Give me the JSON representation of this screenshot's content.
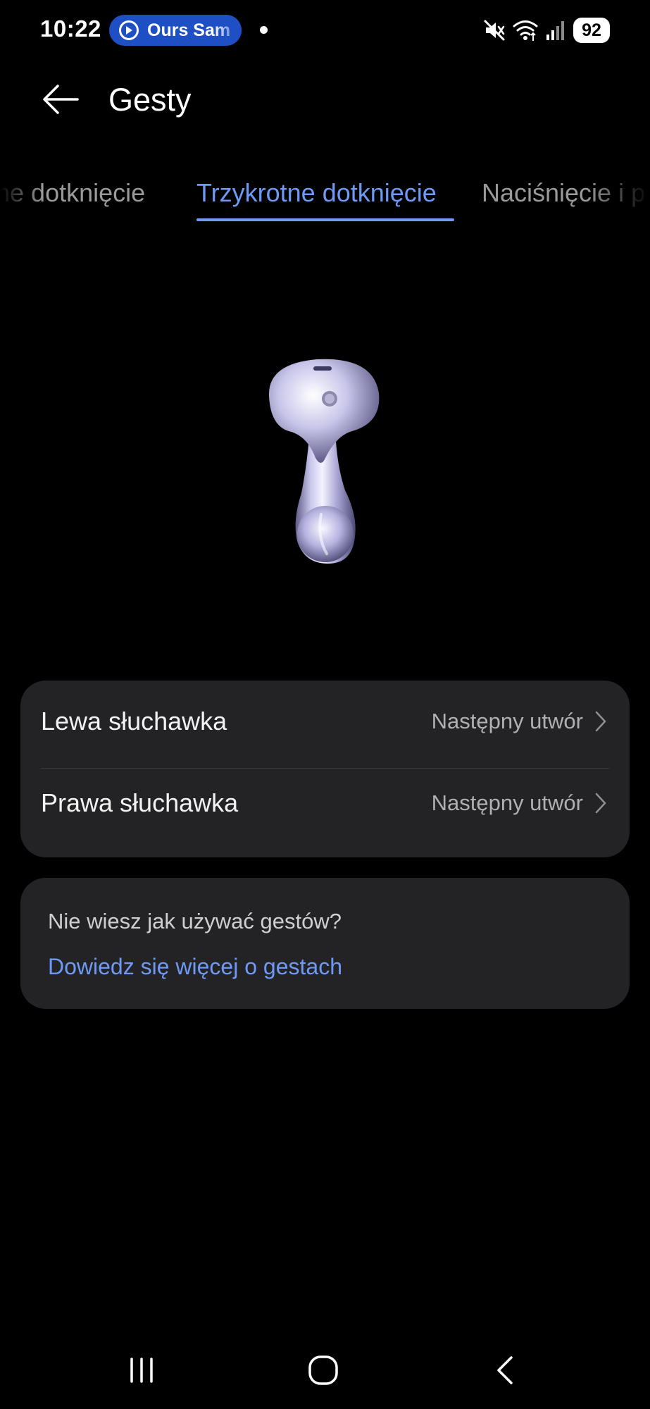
{
  "status_bar": {
    "time": "10:22",
    "notification_pill": "Ours Sam",
    "battery": "92",
    "icons": [
      "mute-icon",
      "wifi-icon",
      "signal-icon",
      "battery-icon"
    ]
  },
  "header": {
    "title": "Gesty",
    "back_icon": "arrow-left-icon"
  },
  "tabs": [
    {
      "label": "Dwukrotne dotknięcie",
      "visible_text": "ne dotknięcie",
      "active": false
    },
    {
      "label": "Trzykrotne dotknięcie",
      "active": true
    },
    {
      "label": "Naciśnięcie i przytrzymanie",
      "visible_text": "Naciśnięcie i p",
      "active": false
    }
  ],
  "image": {
    "icon": "earbud-illustration"
  },
  "settings": {
    "rows": [
      {
        "label": "Lewa słuchawka",
        "value": "Następny utwór"
      },
      {
        "label": "Prawa słuchawka",
        "value": "Następny utwór"
      }
    ]
  },
  "help": {
    "question": "Nie wiesz jak używać gestów?",
    "link": "Dowiedz się więcej o gestach"
  },
  "nav_bar": {
    "icons": [
      "recents-icon",
      "home-icon",
      "back-icon"
    ]
  },
  "colors": {
    "background": "#000000",
    "card": "#232325",
    "accent": "#6e9af5",
    "pill": "#1e4fc4",
    "secondary_text": "#b0b0b0"
  }
}
